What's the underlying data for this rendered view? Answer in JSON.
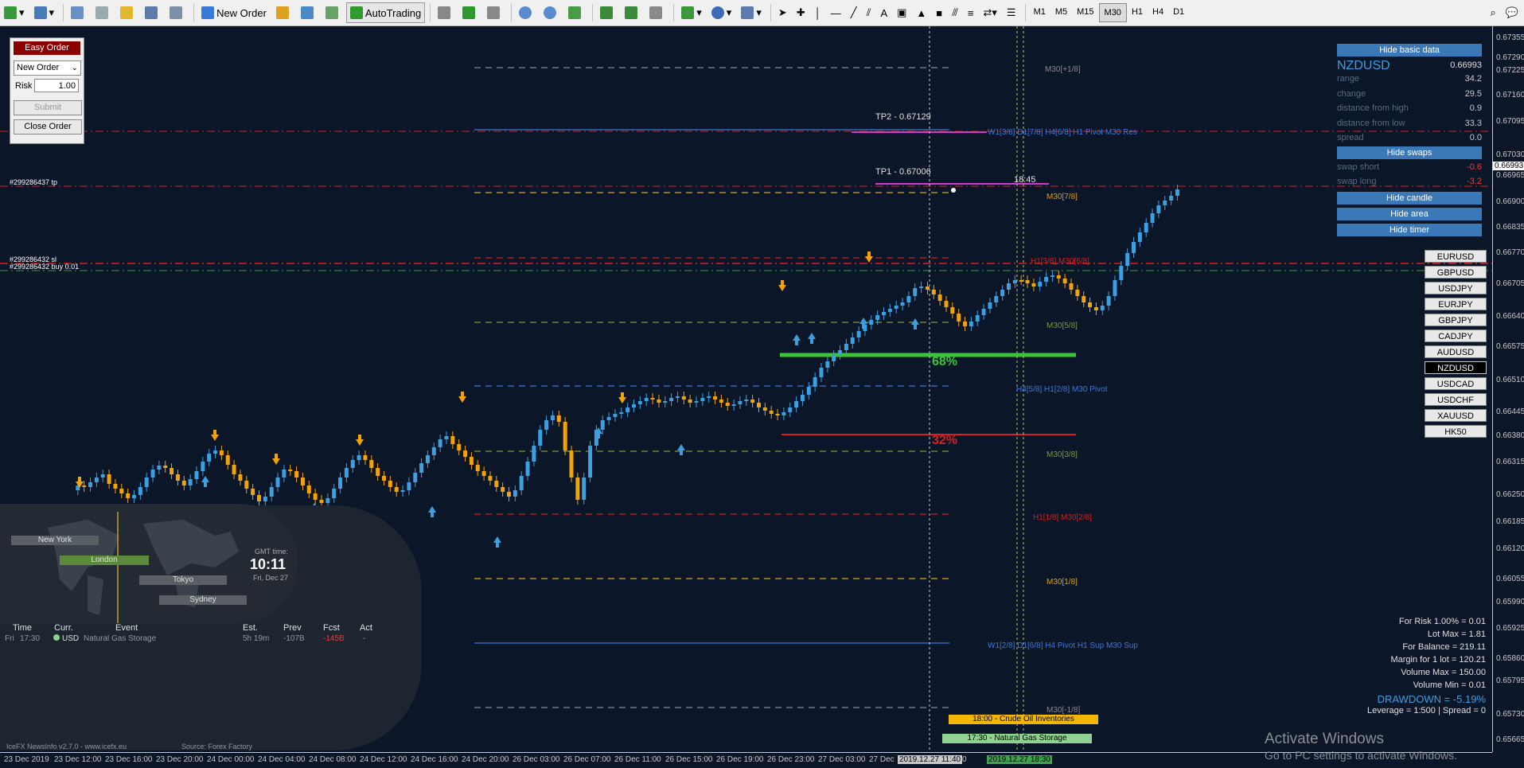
{
  "toolbar": {
    "new_order": "New Order",
    "auto_trading": "AutoTrading",
    "timeframes": [
      "M1",
      "M5",
      "M15",
      "M30",
      "H1",
      "H4",
      "D1"
    ],
    "active_timeframe": "M30"
  },
  "easy_order": {
    "title": "Easy Order",
    "order_type": "New Order",
    "risk_label": "Risk",
    "risk_value": "1.00",
    "submit_label": "Submit",
    "close_label": "Close Order"
  },
  "basic_data": {
    "hide_label": "Hide basic data",
    "symbol": "NZDUSD",
    "price": "0.66993",
    "rows": [
      {
        "label": "range",
        "value": "34.2",
        "color": "#c8c8c8"
      },
      {
        "label": "change",
        "value": "29.5",
        "color": "#c8c8c8"
      },
      {
        "label": "distance from high",
        "value": "0.9",
        "color": "#c8c8c8"
      },
      {
        "label": "distance from low",
        "value": "33.3",
        "color": "#c8c8c8"
      },
      {
        "label": "spread",
        "value": "0.0",
        "color": "#5a6a80"
      }
    ],
    "hide_swaps": "Hide swaps",
    "swaps": [
      {
        "label": "swap short",
        "value": "-0.6"
      },
      {
        "label": "swap long",
        "value": "-3.2"
      }
    ],
    "hide_candle": "Hide candle",
    "hide_area": "Hide area",
    "hide_timer": "Hide timer"
  },
  "symbols": [
    "EURUSD",
    "GBPUSD",
    "USDJPY",
    "EURJPY",
    "GBPJPY",
    "CADJPY",
    "AUDUSD",
    "NZDUSD",
    "USDCAD",
    "USDCHF",
    "XAUUSD",
    "HK50"
  ],
  "current_symbol": "NZDUSD",
  "price_ticks": [
    "0.67355",
    "0.67290",
    "0.67225",
    "0.67160",
    "0.67095",
    "0.67030",
    "0.66993",
    "0.66965",
    "0.66900",
    "0.66835",
    "0.66770",
    "0.66705",
    "0.66640",
    "0.66575",
    "0.66510",
    "0.66445",
    "0.66380",
    "0.66315",
    "0.66250",
    "0.66185",
    "0.66120",
    "0.66055",
    "0.65990",
    "0.65925",
    "0.65860",
    "0.65795",
    "0.65730",
    "0.65665"
  ],
  "time_ticks": [
    "23 Dec 2019",
    "23 Dec 12:00",
    "23 Dec 16:00",
    "23 Dec 20:00",
    "24 Dec 00:00",
    "24 Dec 04:00",
    "24 Dec 08:00",
    "24 Dec 12:00",
    "24 Dec 16:00",
    "24 Dec 20:00",
    "26 Dec 03:00",
    "26 Dec 07:00",
    "26 Dec 11:00",
    "26 Dec 15:00",
    "26 Dec 19:00",
    "26 Dec 23:00",
    "27 Dec 03:00",
    "27 Dec"
  ],
  "time_markers": {
    "cursor": "2019.12.27 11:40",
    "cursor_tail": "0",
    "event": "2019.12.27 18:30"
  },
  "levels": [
    {
      "name": "M30[+1/8]",
      "color": "#8a8a8a"
    },
    {
      "name": "W1[3/8] D1[7/8] H4[6/8] H1 Pivot M30 Res",
      "color": "#3b78d8"
    },
    {
      "name": "M30[7/8]",
      "color": "#d9a21b"
    },
    {
      "name": "H1[3/8] M30[6/8]",
      "color": "#d42020"
    },
    {
      "name": "M30[5/8]",
      "color": "#7a9a3a"
    },
    {
      "name": "H4[5/8] H1[2/8] M30 Pivot",
      "color": "#3b78d8"
    },
    {
      "name": "M30[3/8]",
      "color": "#7a9a3a"
    },
    {
      "name": "H1[1/8] M30[2/8]",
      "color": "#d42020"
    },
    {
      "name": "M30[1/8]",
      "color": "#d9a21b"
    },
    {
      "name": "W1[2/8] D1[6/8] H4 Pivot H1 Sup M30 Sup",
      "color": "#3b78d8"
    },
    {
      "name": "M30[-1/8]",
      "color": "#8a8a8a"
    }
  ],
  "trade_labels": {
    "tp": "#299286437 tp",
    "sl": "#299286432 sl",
    "buy": "#299286432 buy 0.01"
  },
  "targets": {
    "tp2": "TP2 - 0.67129",
    "tp1": "TP1 - 0.67006",
    "timer": "18:45"
  },
  "percent": {
    "up": "68%",
    "down": "32%"
  },
  "news": {
    "cities": [
      "New York",
      "London",
      "Tokyo",
      "Sydney"
    ],
    "gmt_label": "GMT time:",
    "gmt_time": "10:11",
    "gmt_date": "Fri, Dec 27",
    "headers": [
      "Time",
      "Curr.",
      "Event",
      "Est.",
      "Prev",
      "Fcst",
      "Act"
    ],
    "row": {
      "day": "Fri",
      "time": "17:30",
      "currency": "USD",
      "event": "Natural Gas Storage",
      "est": "5h 19m",
      "prev": "-107B",
      "fcst": "-145B",
      "act": "-"
    },
    "footer_left": "IceFX NewsInfo v2.7.0 - www.icefx.eu",
    "footer_source": "Source: Forex Factory"
  },
  "events_chart": [
    {
      "label": "18:00 - Crude Oil Inventories",
      "color": "#f2b705"
    },
    {
      "label": "17:30 - Natural Gas Storage",
      "color": "#8fd18f"
    }
  ],
  "account": [
    {
      "text": "For Risk 1.00% = 0.01",
      "color": "#e0e0e0"
    },
    {
      "text": "Lot Max = 1.81",
      "color": "#e0e0e0"
    },
    {
      "text": "For Balance = 219.11",
      "color": "#e0e0e0"
    },
    {
      "text": "Margin for 1 lot = 120.21",
      "color": "#e0e0e0"
    },
    {
      "text": "Volume Max = 150.00",
      "color": "#e0e0e0"
    },
    {
      "text": "Volume Min = 0.01",
      "color": "#e0e0e0"
    },
    {
      "text": "DRAWDOWN = -5.19%",
      "color": "#3b9fe0"
    },
    {
      "text": "Leverage = 1:500 | Spread = 0",
      "color": "#e0e0e0"
    }
  ],
  "watermark": {
    "title": "Activate Windows",
    "subtitle": "Go to PC settings to activate Windows."
  }
}
